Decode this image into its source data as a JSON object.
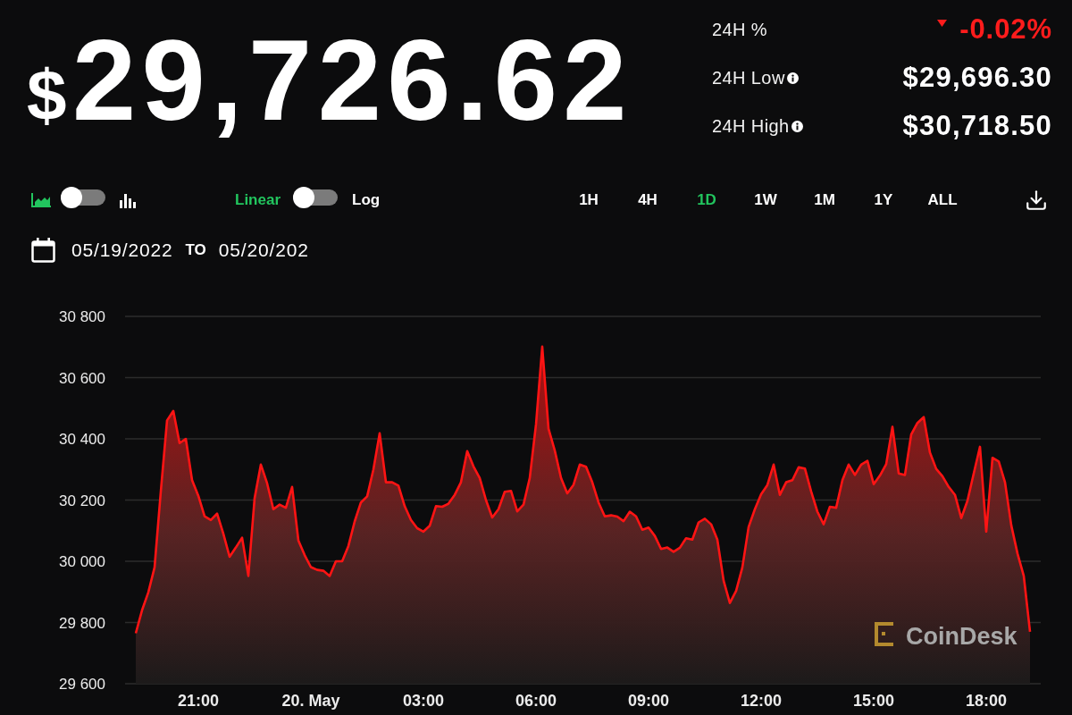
{
  "price": {
    "currency_symbol": "$",
    "amount": "29,726.62"
  },
  "stats": [
    {
      "kind": "change",
      "label": "24H %",
      "value": "-0.02%",
      "negative": true
    },
    {
      "kind": "range",
      "label": "24H Low",
      "value": "$29,696.30"
    },
    {
      "kind": "range",
      "label": "24H High",
      "value": "$30,718.50"
    }
  ],
  "chart_type_toggle": [
    {
      "kind": "area",
      "selected": true
    },
    {
      "kind": "bar",
      "selected": false
    }
  ],
  "scale_toggle": [
    {
      "label": "Linear",
      "selected": true
    },
    {
      "label": "Log",
      "selected": false
    }
  ],
  "timeframes": [
    {
      "label": "1H",
      "selected": false
    },
    {
      "label": "4H",
      "selected": false
    },
    {
      "label": "1D",
      "selected": true
    },
    {
      "label": "1W",
      "selected": false
    },
    {
      "label": "1M",
      "selected": false
    },
    {
      "label": "1Y",
      "selected": false
    },
    {
      "label": "ALL",
      "selected": false
    }
  ],
  "date_range": {
    "start": "05/19/2022",
    "separator": "TO",
    "end": "05/20/202"
  },
  "chart": {
    "logo": "CoinDesk",
    "chart_data": {
      "type": "area",
      "grid": true,
      "ylim": [
        29600,
        30800
      ],
      "yticks": [
        {
          "value": 29600,
          "label": "29 600"
        },
        {
          "value": 29800,
          "label": "29 800"
        },
        {
          "value": 30000,
          "label": "30 000"
        },
        {
          "value": 30200,
          "label": "30 200"
        },
        {
          "value": 30400,
          "label": "30 400"
        },
        {
          "value": 30600,
          "label": "30 600"
        },
        {
          "value": 30800,
          "label": "30 800"
        }
      ],
      "categories": [
        null,
        null,
        null,
        null,
        null,
        null,
        null,
        null,
        null,
        null,
        "21:00",
        null,
        null,
        null,
        null,
        null,
        null,
        null,
        null,
        null,
        null,
        null,
        null,
        null,
        null,
        null,
        null,
        null,
        "20. May",
        null,
        null,
        null,
        null,
        null,
        null,
        null,
        null,
        null,
        null,
        null,
        null,
        null,
        null,
        null,
        null,
        null,
        "03:00",
        null,
        null,
        null,
        null,
        null,
        null,
        null,
        null,
        null,
        null,
        null,
        null,
        null,
        null,
        null,
        null,
        null,
        "06:00",
        null,
        null,
        null,
        null,
        null,
        null,
        null,
        null,
        null,
        null,
        null,
        null,
        null,
        null,
        null,
        null,
        null,
        "09:00",
        null,
        null,
        null,
        null,
        null,
        null,
        null,
        null,
        null,
        null,
        null,
        null,
        null,
        null,
        null,
        null,
        null,
        "12:00",
        null,
        null,
        null,
        null,
        null,
        null,
        null,
        null,
        null,
        null,
        null,
        null,
        null,
        null,
        null,
        null,
        null,
        "15:00",
        null,
        null,
        null,
        null,
        null,
        null,
        null,
        null,
        null,
        null,
        null,
        null,
        null,
        null,
        null,
        null,
        null,
        "18:00",
        null,
        null,
        null,
        null,
        null,
        null,
        null
      ],
      "values": [
        29765,
        29840,
        29898,
        29980,
        30228,
        30460,
        30491,
        30386,
        30400,
        30265,
        30214,
        30147,
        30135,
        30156,
        30090,
        30015,
        30045,
        30077,
        29952,
        30206,
        30316,
        30255,
        30170,
        30185,
        30175,
        30243,
        30068,
        30020,
        29981,
        29972,
        29969,
        29952,
        30000,
        30000,
        30050,
        30130,
        30192,
        30212,
        30300,
        30418,
        30258,
        30258,
        30247,
        30180,
        30135,
        30108,
        30097,
        30116,
        30180,
        30178,
        30188,
        30217,
        30258,
        30360,
        30310,
        30272,
        30200,
        30143,
        30170,
        30227,
        30230,
        30163,
        30185,
        30272,
        30447,
        30701,
        30433,
        30362,
        30272,
        30222,
        30250,
        30316,
        30309,
        30258,
        30192,
        30147,
        30150,
        30146,
        30131,
        30162,
        30147,
        30103,
        30110,
        30083,
        30040,
        30045,
        30031,
        30044,
        30075,
        30071,
        30127,
        30139,
        30121,
        30071,
        29937,
        29864,
        29903,
        29980,
        30112,
        30170,
        30219,
        30249,
        30316,
        30217,
        30258,
        30265,
        30307,
        30303,
        30228,
        30162,
        30121,
        30178,
        30175,
        30265,
        30316,
        30282,
        30316,
        30328,
        30252,
        30280,
        30317,
        30439,
        30287,
        30282,
        30414,
        30452,
        30471,
        30355,
        30302,
        30278,
        30243,
        30217,
        30141,
        30198,
        30287,
        30374,
        30097,
        30338,
        30326,
        30258,
        30118,
        30025,
        29952,
        29770
      ]
    }
  }
}
